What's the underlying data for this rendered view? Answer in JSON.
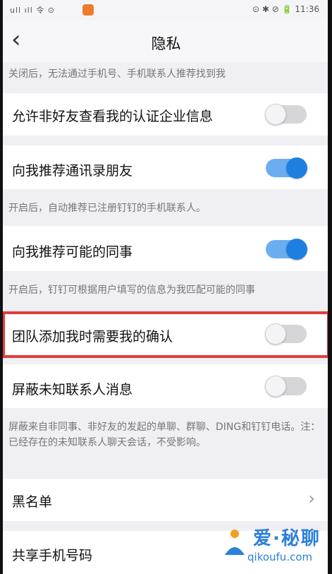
{
  "status_bar": {
    "left_text": "ull ıll 令 ⊙",
    "right_text": "⊙ ✱ ⊘ 🔋 11:36"
  },
  "nav": {
    "title": "隐私"
  },
  "descriptions": {
    "top": "关闭后，无法通过手机号、手机联系人推荐找到我",
    "contacts": "开启后，自动推荐已注册钉钉的手机联系人。",
    "colleagues": "开启后，钉钉可根据用户填写的信息为我匹配可能的同事",
    "unknown": "屏蔽来自非同事、非好友的发起的单聊、群聊、DING和钉钉电话。注：已经存在的未知联系人聊天会话，不受影响。"
  },
  "settings": [
    {
      "label": "允许非好友查看我的认证企业信息",
      "state": "off"
    },
    {
      "label": "向我推荐通讯录朋友",
      "state": "on"
    },
    {
      "label": "向我推荐可能的同事",
      "state": "on"
    },
    {
      "label": "团队添加我时需要我的确认",
      "state": "off"
    },
    {
      "label": "屏蔽未知联系人消息",
      "state": "off"
    },
    {
      "label": "黑名单"
    },
    {
      "label": "共享手机号码"
    }
  ],
  "watermark": {
    "brand": "爱·秘聊",
    "site": "qikoufu.com"
  },
  "colors": {
    "accent": "#1f7fe0",
    "highlight": "#e33c3c"
  }
}
